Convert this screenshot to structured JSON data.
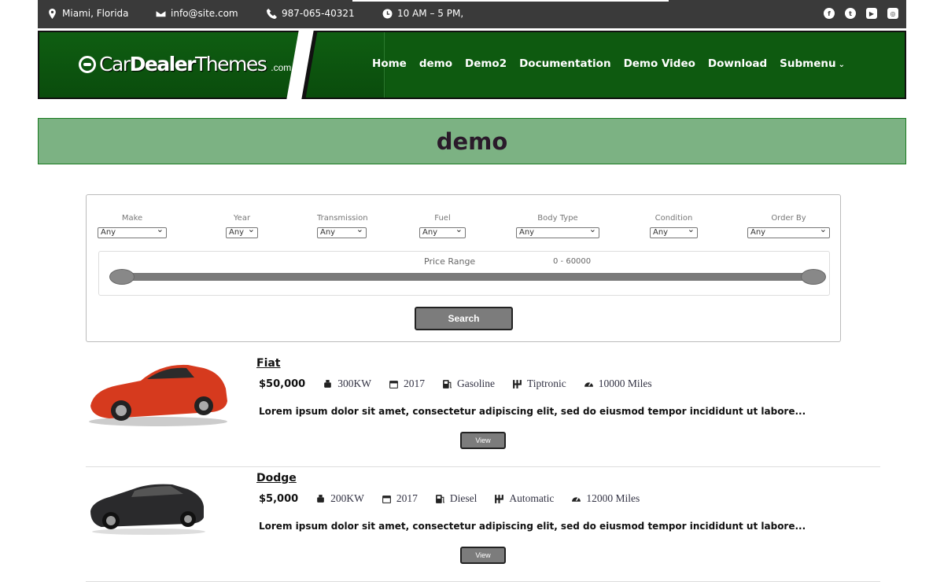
{
  "topbar": {
    "location": "Miami, Florida",
    "email": "info@site.com",
    "phone": "987-065-40321",
    "hours": "10 AM – 5 PM,",
    "social": [
      {
        "icon": "facebook-icon",
        "glyph": "f"
      },
      {
        "icon": "twitter-icon",
        "glyph": "t"
      },
      {
        "icon": "youtube-icon",
        "glyph": "▶"
      },
      {
        "icon": "instagram-icon",
        "glyph": "◎"
      }
    ]
  },
  "header": {
    "logo": {
      "part1": "Car",
      "part2": "Dealer",
      "part3": "Themes",
      "suffix": ".com"
    },
    "nav": [
      "Home",
      "demo",
      "Demo2",
      "Documentation",
      "Demo Video",
      "Download",
      "Submenu"
    ]
  },
  "page": {
    "title": "demo"
  },
  "search": {
    "filters": [
      {
        "label": "Make",
        "value": "Any"
      },
      {
        "label": "Year",
        "value": "Any"
      },
      {
        "label": "Transmission",
        "value": "Any"
      },
      {
        "label": "Fuel",
        "value": "Any"
      },
      {
        "label": "Body Type",
        "value": "Any"
      },
      {
        "label": "Condition",
        "value": "Any"
      },
      {
        "label": "Order By",
        "value": "Any"
      }
    ],
    "price_label": "Price Range",
    "price_value": "0 - 60000",
    "button": "Search"
  },
  "listings": [
    {
      "name": "Fiat",
      "price": "$50,000",
      "power": "300KW",
      "year": "2017",
      "fuel": "Gasoline",
      "transmission": "Tiptronic",
      "mileage": "10000  Miles",
      "description": "Lorem ipsum dolor sit amet, consectetur adipiscing elit, sed do eiusmod tempor incididunt ut labore...",
      "button": "View",
      "car_color": "#d63a1e"
    },
    {
      "name": "Dodge",
      "price": "$5,000",
      "power": "200KW",
      "year": "2017",
      "fuel": "Diesel",
      "transmission": "Automatic",
      "mileage": "12000  Miles",
      "description": "Lorem ipsum dolor sit amet, consectetur adipiscing elit, sed do eiusmod tempor incididunt ut labore...",
      "button": "View",
      "car_color": "#2a2a2c"
    }
  ]
}
